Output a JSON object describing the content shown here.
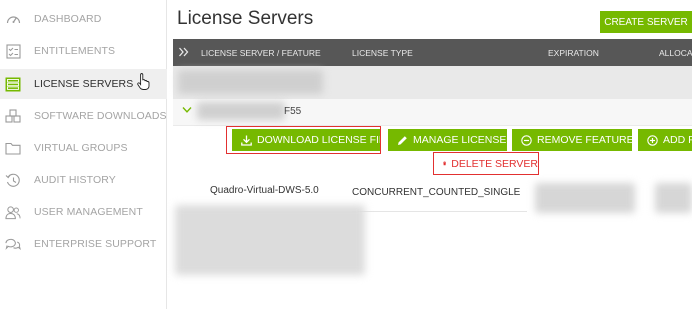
{
  "sidebar": {
    "items": [
      {
        "label": "DASHBOARD",
        "icon": "dashboard-icon"
      },
      {
        "label": "ENTITLEMENTS",
        "icon": "entitlements-icon"
      },
      {
        "label": "LICENSE SERVERS",
        "icon": "license-servers-icon",
        "active": true
      },
      {
        "label": "SOFTWARE DOWNLOADS",
        "icon": "software-downloads-icon"
      },
      {
        "label": "VIRTUAL GROUPS",
        "icon": "folder-icon"
      },
      {
        "label": "AUDIT HISTORY",
        "icon": "history-icon"
      },
      {
        "label": "USER MANAGEMENT",
        "icon": "users-icon"
      },
      {
        "label": "ENTERPRISE SUPPORT",
        "icon": "support-chat-icon"
      }
    ]
  },
  "header": {
    "title": "License Servers",
    "create_label": "CREATE SERVER"
  },
  "table": {
    "columns": [
      "LICENSE SERVER / FEATURE",
      "LICENSE TYPE",
      "EXPIRATION",
      "ALLOCAT"
    ]
  },
  "server": {
    "name_suffix": "F55",
    "actions": {
      "download": "DOWNLOAD LICENSE FILE",
      "manage": "MANAGE LICENSES",
      "remove": "REMOVE FEATURES",
      "add": "ADD FE",
      "delete": "DELETE SERVER"
    },
    "feature": {
      "name": "Quadro-Virtual-DWS-5.0",
      "license_type": "CONCURRENT_COUNTED_SINGLE"
    }
  },
  "colors": {
    "accent": "#76b900",
    "danger": "#e23030",
    "header_bg": "#575757"
  }
}
